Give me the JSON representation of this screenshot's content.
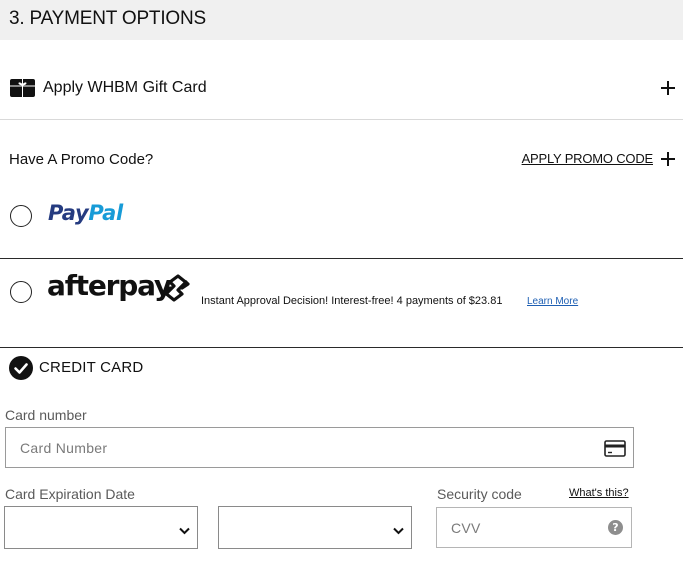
{
  "section": {
    "title": "3. PAYMENT OPTIONS"
  },
  "gift_card": {
    "label": "Apply WHBM Gift Card",
    "icon": "gift-card-icon"
  },
  "promo": {
    "label": "Have A Promo Code?",
    "link": "APPLY PROMO CODE"
  },
  "paypal": {
    "logo_part1": "Pay",
    "logo_part2": "Pal",
    "colors": {
      "pay": "#253b80",
      "pal": "#179bd7"
    }
  },
  "afterpay": {
    "logo_text": "afterpay",
    "info": "Instant Approval Decision! Interest-free! 4 payments of $23.81",
    "learn_more": "Learn More"
  },
  "credit_card": {
    "label": "CREDIT CARD",
    "selected": true,
    "card_number_label": "Card number",
    "card_number_placeholder": "Card Number",
    "card_number_value": "",
    "expiration_label": "Card Expiration Date",
    "expiration_month_value": "",
    "expiration_year_value": "",
    "security_label": "Security code",
    "whats_this": "What's this?",
    "cvv_placeholder": "CVV",
    "cvv_value": "",
    "help_glyph": "?"
  },
  "colors": {
    "header_bg": "#f0f0f0",
    "link_blue": "#1e5fb3",
    "accent": "#111111"
  }
}
